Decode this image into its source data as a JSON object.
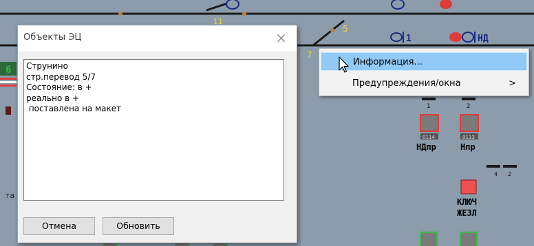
{
  "scheme": {
    "switch_numbers": [
      "5",
      "7",
      "11"
    ],
    "signals_top": [
      "1",
      "НД"
    ],
    "track_numbers": [
      "1",
      "2"
    ],
    "small_codes": [
      "0114",
      "0113"
    ],
    "signal_labels": [
      "НДпр",
      "Нпр"
    ],
    "track_marks": [
      "4",
      "2"
    ],
    "key_label": [
      "КЛЮЧ",
      "ЖЕЗЛ"
    ],
    "left_fragments": [
      "6",
      "та"
    ],
    "colors": {
      "background": "#8c9cab",
      "track": "#1a1a1a",
      "red": "#e03b3b",
      "green": "#3cb64a",
      "yellow": "#f0d838",
      "lamp_grey": "#7a7a7a"
    }
  },
  "dialog": {
    "title": "Объекты ЭЦ",
    "close_icon": "×",
    "lines": [
      "Струнино",
      "стр.перевод 5/7",
      "Состояние: в +",
      "реально в +",
      " поставлена на макет"
    ],
    "cancel_label": "Отмена",
    "update_label": "Обновить"
  },
  "context_menu": {
    "items": [
      {
        "label": "Информация...",
        "selected": true
      },
      {
        "label": "Предупреждения/окна",
        "submenu_arrow": ">"
      }
    ]
  }
}
